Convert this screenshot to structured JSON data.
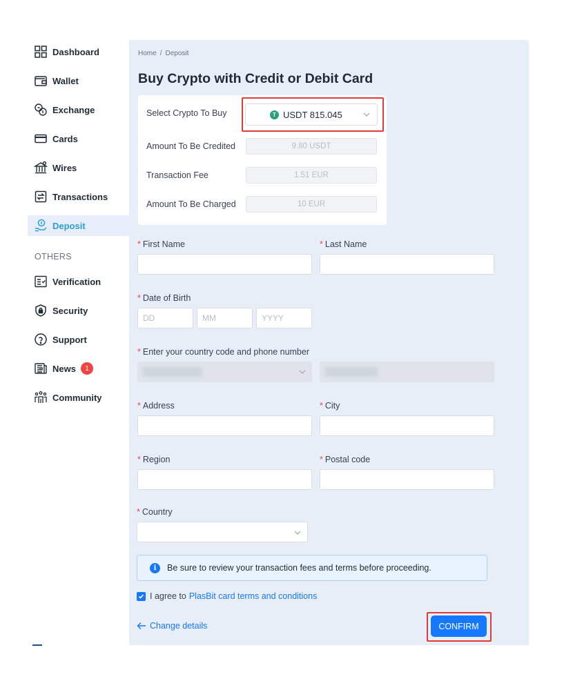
{
  "sidebar": {
    "items": [
      {
        "label": "Dashboard",
        "icon": "dashboard-icon"
      },
      {
        "label": "Wallet",
        "icon": "wallet-icon"
      },
      {
        "label": "Exchange",
        "icon": "exchange-icon"
      },
      {
        "label": "Cards",
        "icon": "card-icon"
      },
      {
        "label": "Wires",
        "icon": "bank-icon"
      },
      {
        "label": "Transactions",
        "icon": "transactions-icon"
      },
      {
        "label": "Deposit",
        "icon": "deposit-icon",
        "active": true
      }
    ],
    "others_label": "OTHERS",
    "others": [
      {
        "label": "Verification",
        "icon": "verification-icon"
      },
      {
        "label": "Security",
        "icon": "shield-lock-icon"
      },
      {
        "label": "Support",
        "icon": "help-icon"
      },
      {
        "label": "News",
        "icon": "news-icon",
        "badge": "1"
      },
      {
        "label": "Community",
        "icon": "community-icon"
      }
    ]
  },
  "breadcrumb": {
    "home": "Home",
    "sep": "/",
    "current": "Deposit"
  },
  "page_title": "Buy Crypto with Credit or Debit Card",
  "summary": {
    "select_label": "Select Crypto To Buy",
    "crypto_value": "USDT 815.045",
    "crypto_icon_letter": "T",
    "credited_label": "Amount To Be Credited",
    "credited_value": "9.80 USDT",
    "fee_label": "Transaction Fee",
    "fee_value": "1.51 EUR",
    "charged_label": "Amount To Be Charged",
    "charged_value": "10 EUR"
  },
  "form": {
    "required_mark": "*",
    "first_name_label": "First Name",
    "last_name_label": "Last Name",
    "dob_label": "Date of Birth",
    "dob_dd_placeholder": "DD",
    "dob_mm_placeholder": "MM",
    "dob_yyyy_placeholder": "YYYY",
    "phone_label": "Enter your country code and phone number",
    "address_label": "Address",
    "city_label": "City",
    "region_label": "Region",
    "postal_label": "Postal code",
    "country_label": "Country"
  },
  "info_message": "Be sure to review your transaction fees and terms before proceeding.",
  "info_icon_letter": "i",
  "agree": {
    "prefix": "I agree to",
    "link": "PlasBit card terms and conditions",
    "checked": true
  },
  "change_details_label": "Change details",
  "confirm_label": "CONFIRM",
  "colors": {
    "accent": "#1677ff",
    "highlight": "#e53935",
    "active_nav": "#2a9fd8",
    "panel_bg": "#e8eef8"
  }
}
